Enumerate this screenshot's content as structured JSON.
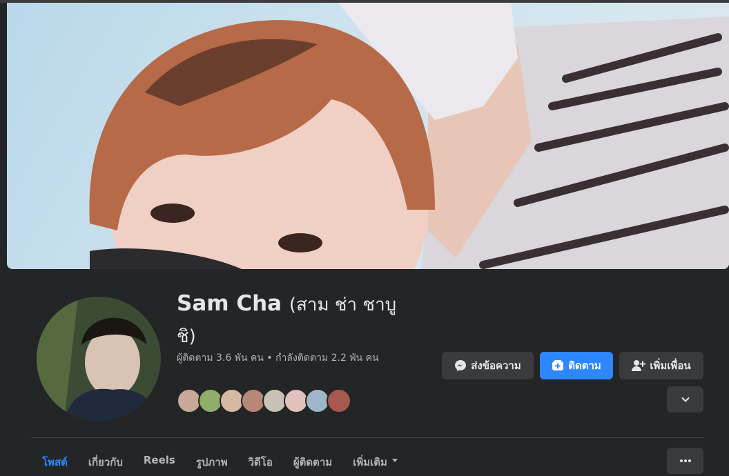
{
  "profile": {
    "name_latin": "Sam Cha",
    "name_thai": "(สาม ช่า ชาบูชิ)",
    "followers_text": "ผู้ติดตาม 3.6 พัน คน • กำลังติดตาม 2.2 พัน คน"
  },
  "actions": {
    "message_label": "ส่งข้อความ",
    "follow_label": "ติดตาม",
    "add_friend_label": "เพิ่มเพื่อน"
  },
  "icons": {
    "message": "messenger-icon",
    "follow": "follow-icon",
    "add_friend": "add-friend-icon",
    "expand": "chevron-down-icon",
    "more": "ellipsis-icon",
    "tab_more": "caret-down-icon"
  },
  "tabs": [
    {
      "label": "โพสต์",
      "active": true
    },
    {
      "label": "เกี่ยวกับ",
      "active": false
    },
    {
      "label": "Reels",
      "active": false
    },
    {
      "label": "รูปภาพ",
      "active": false
    },
    {
      "label": "วิดีโอ",
      "active": false
    },
    {
      "label": "ผู้ติดตาม",
      "active": false
    },
    {
      "label": "เพิ่มเติม",
      "active": false
    }
  ],
  "colors": {
    "background": "#242526",
    "button": "#3a3b3c",
    "accent": "#2d88ff",
    "text_primary": "#e4e6eb",
    "text_secondary": "#b0b3b8"
  }
}
